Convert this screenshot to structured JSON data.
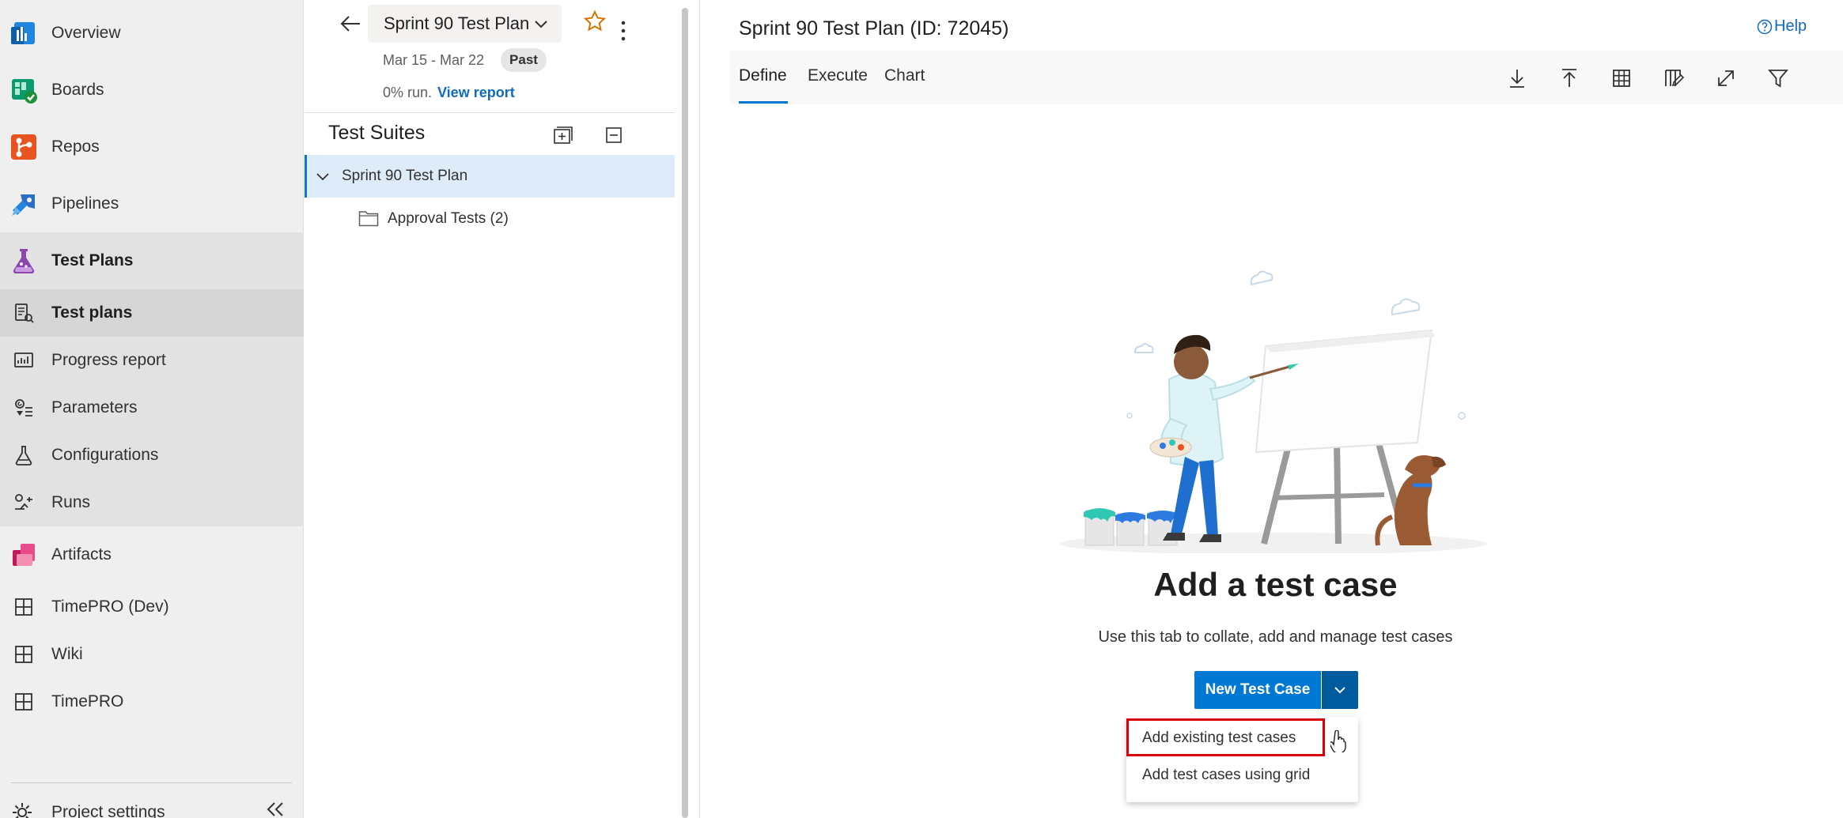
{
  "nav": {
    "items": [
      {
        "label": "Overview",
        "icon": "overview-icon"
      },
      {
        "label": "Boards",
        "icon": "boards-icon"
      },
      {
        "label": "Repos",
        "icon": "repos-icon"
      },
      {
        "label": "Pipelines",
        "icon": "pipelines-icon"
      },
      {
        "label": "Test Plans",
        "icon": "test-plans-icon"
      },
      {
        "label": "Test plans",
        "icon": "test-plans-list-icon"
      },
      {
        "label": "Progress report",
        "icon": "progress-report-icon"
      },
      {
        "label": "Parameters",
        "icon": "parameters-icon"
      },
      {
        "label": "Configurations",
        "icon": "configurations-icon"
      },
      {
        "label": "Runs",
        "icon": "runs-icon"
      },
      {
        "label": "Artifacts",
        "icon": "artifacts-icon"
      },
      {
        "label": "TimePRO (Dev)",
        "icon": "grid-icon"
      },
      {
        "label": "Wiki",
        "icon": "grid-icon"
      },
      {
        "label": "TimePRO",
        "icon": "grid-icon"
      }
    ],
    "project_settings": "Project settings"
  },
  "plan": {
    "name": "Sprint 90 Test Plan",
    "dates": "Mar 15 - Mar 22",
    "status": "Past",
    "run_text": "0% run.",
    "view_report": "View report"
  },
  "suites": {
    "title": "Test Suites",
    "root": "Sprint 90 Test Plan",
    "children": [
      {
        "label": "Approval Tests (2)"
      }
    ]
  },
  "main": {
    "title": "Sprint 90 Test Plan (ID: 72045)",
    "help": "Help",
    "tabs": [
      {
        "label": "Define",
        "active": true
      },
      {
        "label": "Execute"
      },
      {
        "label": "Chart"
      }
    ],
    "toolbar_icons": [
      "export-icon",
      "import-icon",
      "grid-view-icon",
      "column-options-icon",
      "fullscreen-icon",
      "filter-icon"
    ]
  },
  "empty_state": {
    "heading": "Add a test case",
    "description": "Use this tab to collate, add and manage test cases",
    "new_button": "New Test Case",
    "menu": [
      {
        "label": "Add existing test cases",
        "highlighted": true
      },
      {
        "label": "Add test cases using grid"
      }
    ]
  },
  "colors": {
    "accent": "#0078d4",
    "highlight_outline": "#d9000d",
    "link": "#0f6cbd"
  }
}
